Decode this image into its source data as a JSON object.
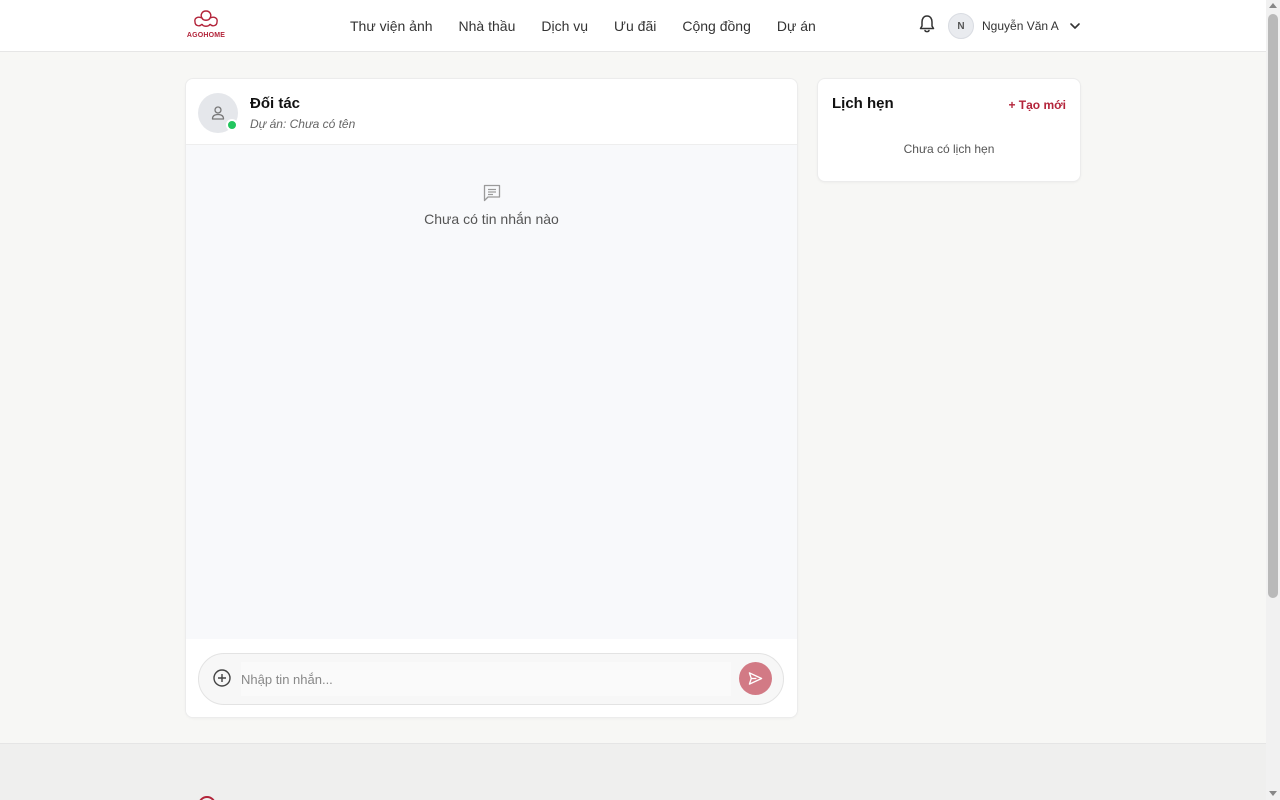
{
  "brand": {
    "logo_text": "AGOHOME",
    "accent_color": "#b3243a"
  },
  "nav": {
    "items": [
      {
        "label": "Thư viện ảnh"
      },
      {
        "label": "Nhà thầu"
      },
      {
        "label": "Dịch vụ"
      },
      {
        "label": "Ưu đãi"
      },
      {
        "label": "Cộng đồng"
      },
      {
        "label": "Dự án"
      }
    ]
  },
  "user": {
    "initial": "N",
    "name": "Nguyễn Văn A"
  },
  "chat": {
    "partner_name": "Đối tác",
    "project_line": "Dự án: Chưa có tên",
    "online_status_color": "#22c55e",
    "empty_text": "Chưa có tin nhắn nào",
    "input_placeholder": "Nhập tin nhắn...",
    "send_button_color": "#d27a85"
  },
  "appointments": {
    "title": "Lịch hẹn",
    "create_label": "+ Tạo mới",
    "empty_text": "Chưa có lịch hẹn"
  }
}
